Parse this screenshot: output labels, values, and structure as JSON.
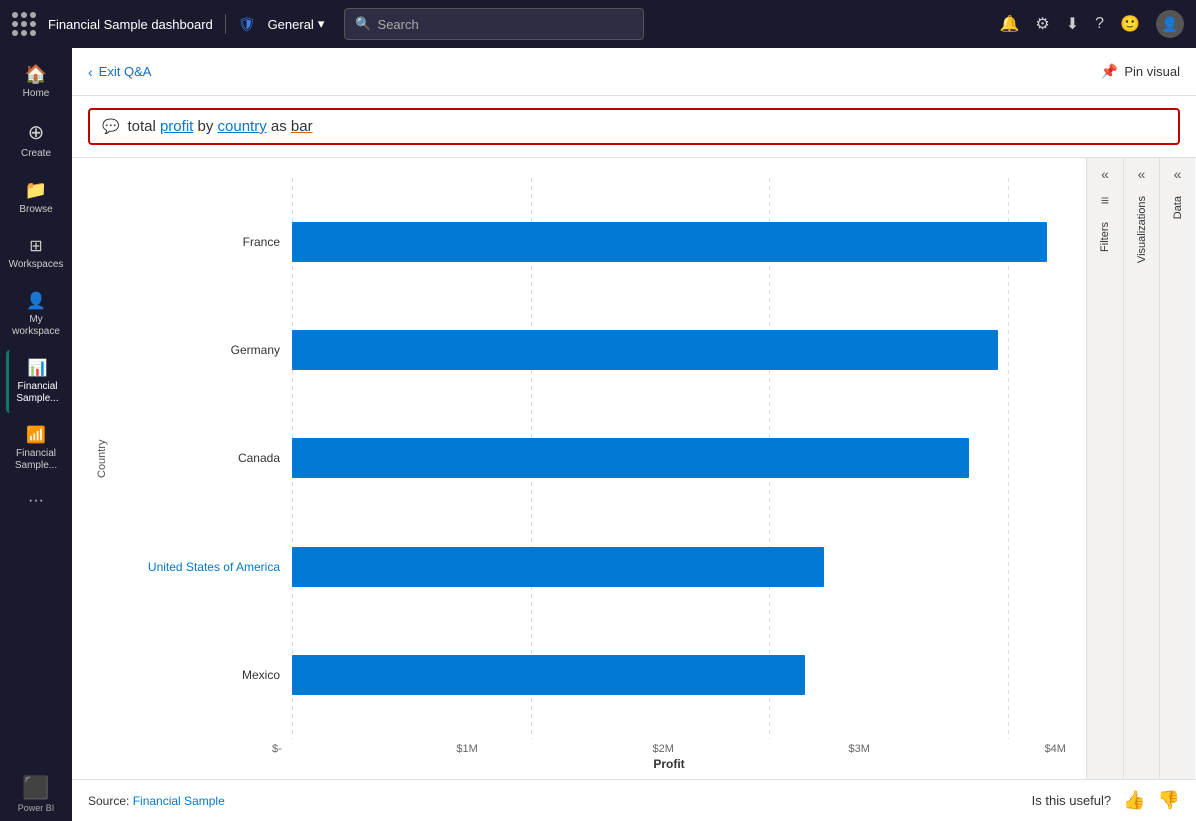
{
  "topnav": {
    "title": "Financial Sample  dashboard",
    "general_label": "General",
    "search_placeholder": "Search"
  },
  "sidebar": {
    "items": [
      {
        "label": "Home",
        "icon": "🏠",
        "active": false
      },
      {
        "label": "Create",
        "icon": "+",
        "active": false
      },
      {
        "label": "Browse",
        "icon": "📁",
        "active": false
      },
      {
        "label": "Workspaces",
        "icon": "⊞",
        "active": false
      },
      {
        "label": "My workspace",
        "icon": "👤",
        "active": false
      },
      {
        "label": "Financial Sample...",
        "icon": "📊",
        "active": true,
        "financial": true
      },
      {
        "label": "Financial Sample...",
        "icon": "📶",
        "active": false
      },
      {
        "label": "...",
        "icon": "...",
        "active": false
      }
    ],
    "powerbi_label": "Power BI"
  },
  "qna": {
    "exit_label": "Exit Q&A",
    "pin_label": "Pin visual",
    "query": "total profit by country as bar",
    "query_parts": [
      {
        "text": "total ",
        "style": "normal"
      },
      {
        "text": "profit",
        "style": "underline-blue"
      },
      {
        "text": " by ",
        "style": "normal"
      },
      {
        "text": "country",
        "style": "underline-blue"
      },
      {
        "text": " as ",
        "style": "normal"
      },
      {
        "text": "bar",
        "style": "underline-orange"
      }
    ]
  },
  "chart": {
    "y_axis_label": "Country",
    "x_axis_label": "Profit",
    "x_ticks": [
      "$-",
      "$1M",
      "$2M",
      "$3M",
      "$4M"
    ],
    "bars": [
      {
        "country": "France",
        "value": 3900000,
        "max": 4000000,
        "link": false
      },
      {
        "country": "Germany",
        "value": 3650000,
        "max": 4000000,
        "link": false
      },
      {
        "country": "Canada",
        "value": 3500000,
        "max": 4000000,
        "link": false
      },
      {
        "country": "United States of America",
        "value": 2750000,
        "max": 4000000,
        "link": true
      },
      {
        "country": "Mexico",
        "value": 2650000,
        "max": 4000000,
        "link": false
      }
    ]
  },
  "panels": {
    "filters_label": "Filters",
    "visualizations_label": "Visualizations",
    "data_label": "Data"
  },
  "bottom": {
    "source_prefix": "Source: ",
    "source_link": "Financial Sample",
    "feedback_question": "Is this useful?",
    "thumbs_up": "👍",
    "thumbs_down": "👎"
  }
}
